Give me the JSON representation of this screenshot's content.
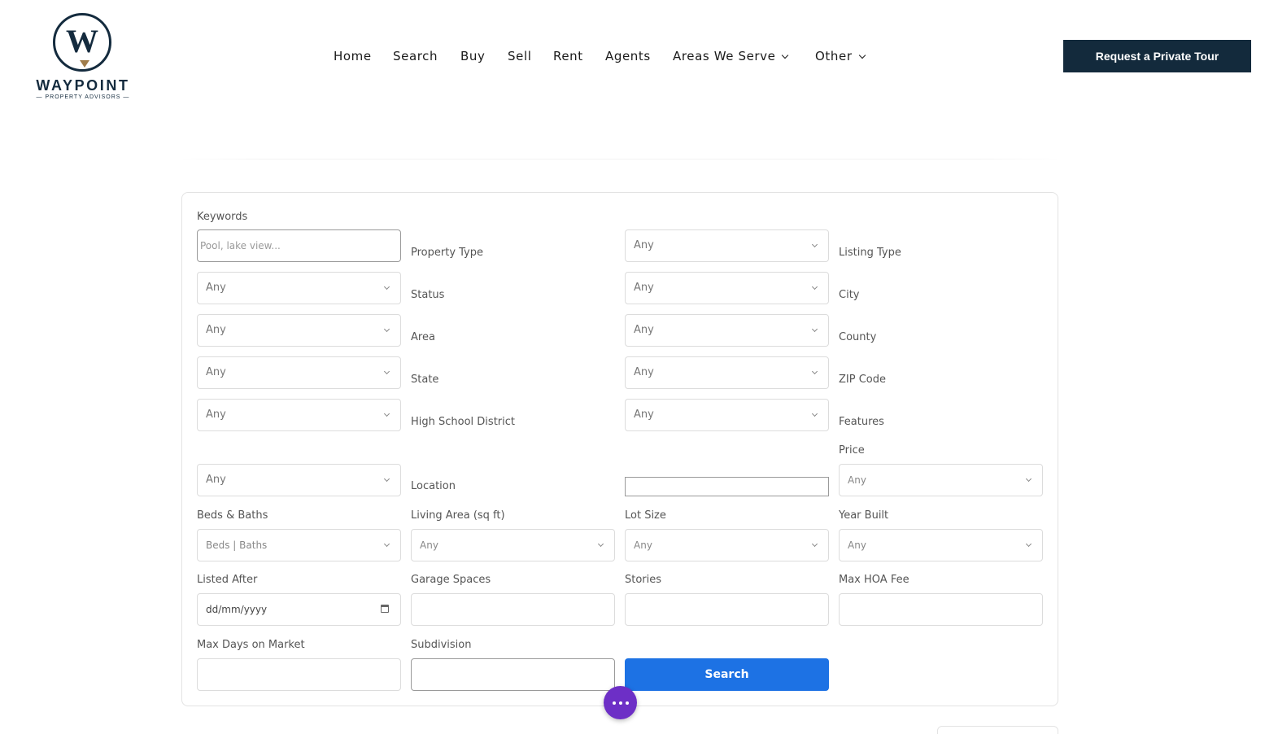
{
  "brand": {
    "logo_letter": "W",
    "name": "WAYPOINT",
    "tagline": "— PROPERTY ADVISORS —"
  },
  "nav": {
    "items": [
      "Home",
      "Search",
      "Buy",
      "Sell",
      "Rent",
      "Agents",
      "Areas We Serve",
      "Other"
    ],
    "cta": "Request a Private Tour"
  },
  "form": {
    "keywords": {
      "label": "Keywords",
      "placeholder": "Pool, lake view..."
    },
    "property_type": {
      "label": "Property Type",
      "value": "Any"
    },
    "listing_type": {
      "label": "Listing Type",
      "value": "Any"
    },
    "status": {
      "label": "Status",
      "value": "Any"
    },
    "city": {
      "label": "City",
      "value": "Any"
    },
    "area": {
      "label": "Area",
      "value": "Any"
    },
    "county": {
      "label": "County",
      "value": "Any"
    },
    "state": {
      "label": "State",
      "value": "Any"
    },
    "zip_code": {
      "label": "ZIP Code",
      "value": "Any"
    },
    "high_school_district": {
      "label": "High School District",
      "value": "Any"
    },
    "features": {
      "label": "Features",
      "value": "Any"
    },
    "location": {
      "label": "Location",
      "value": ""
    },
    "price": {
      "label": "Price",
      "value": "Any"
    },
    "beds_baths": {
      "label": "Beds & Baths",
      "value": "Beds | Baths"
    },
    "living_area": {
      "label": "Living Area (sq ft)",
      "value": "Any"
    },
    "lot_size": {
      "label": "Lot Size",
      "value": "Any"
    },
    "year_built": {
      "label": "Year Built",
      "value": "Any"
    },
    "listed_after": {
      "label": "Listed After",
      "value": "dd/mm/yyyy"
    },
    "garage_spaces": {
      "label": "Garage Spaces",
      "value": ""
    },
    "stories": {
      "label": "Stories",
      "value": ""
    },
    "max_hoa_fee": {
      "label": "Max HOA Fee",
      "value": ""
    },
    "max_days_on_market": {
      "label": "Max Days on Market",
      "value": ""
    },
    "subdivision": {
      "label": "Subdivision",
      "value": ""
    },
    "search_button": "Search"
  },
  "colors": {
    "navy": "#132a3c",
    "gold": "#a07d4c",
    "primary_blue": "#1d72e4",
    "fab_purple": "#6d2fc6"
  },
  "icons": [
    "chevron-down-icon",
    "calendar-icon",
    "more-dots-icon"
  ]
}
